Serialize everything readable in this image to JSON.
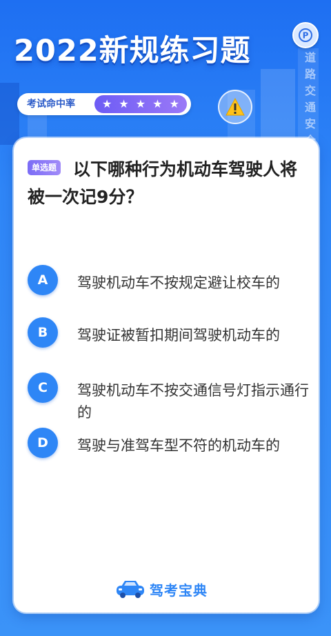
{
  "header": {
    "title": "2022新规练习题",
    "side_vertical_text": "道路交通安全法",
    "rate_label": "考试命中率",
    "stars": [
      "★",
      "★",
      "★",
      "★",
      "★"
    ],
    "logo_icon": "parking-logo-icon",
    "warning_icon": "warning-triangle-icon"
  },
  "question": {
    "type_label": "单选题",
    "text": "以下哪种行为机动车驾驶人将被一次记9分？"
  },
  "options": [
    {
      "letter": "A",
      "text": "驾驶机动车不按规定避让校车的"
    },
    {
      "letter": "B",
      "text": "驾驶证被暂扣期间驾驶机动车的"
    },
    {
      "letter": "C",
      "text": "驾驶机动车不按交通信号灯指示通行的"
    },
    {
      "letter": "D",
      "text": "驾驶与准驾车型不符的机动车的"
    }
  ],
  "footer": {
    "brand_name": "驾考宝典",
    "brand_icon": "car-logo-icon"
  },
  "colors": {
    "background": "#2f86f7",
    "accent": "#2e86f6",
    "badge": "#7b6cf6"
  }
}
